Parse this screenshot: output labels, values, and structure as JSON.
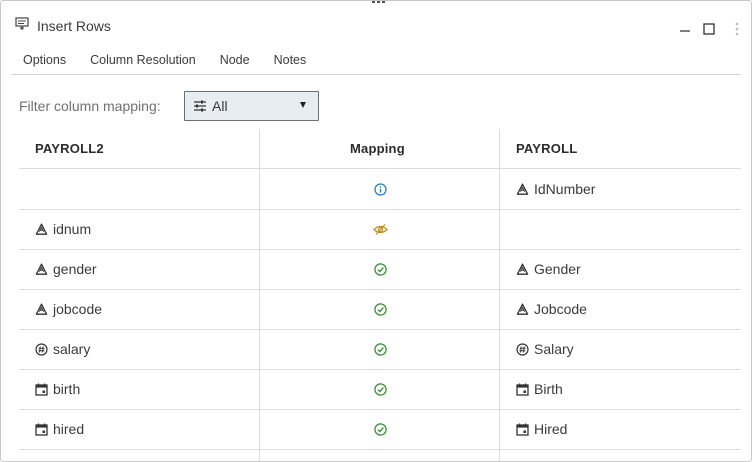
{
  "window": {
    "title": "Insert Rows"
  },
  "tabs": [
    {
      "label": "Options",
      "active": false
    },
    {
      "label": "Column Resolution",
      "active": true
    },
    {
      "label": "Node",
      "active": false
    },
    {
      "label": "Notes",
      "active": false
    }
  ],
  "filter": {
    "label": "Filter column mapping:",
    "selected": "All"
  },
  "table": {
    "headers": {
      "source": "PAYROLL2",
      "mapping": "Mapping",
      "target": "PAYROLL"
    },
    "rows": [
      {
        "source": "",
        "source_type": "",
        "mapping": "info-icon",
        "target": "IdNumber",
        "target_type": "character-icon"
      },
      {
        "source": "idnum",
        "source_type": "character-icon",
        "mapping": "hidden-icon",
        "target": "",
        "target_type": ""
      },
      {
        "source": "gender",
        "source_type": "character-icon",
        "mapping": "check-icon",
        "target": "Gender",
        "target_type": "character-icon"
      },
      {
        "source": "jobcode",
        "source_type": "character-icon",
        "mapping": "check-icon",
        "target": "Jobcode",
        "target_type": "character-icon"
      },
      {
        "source": "salary",
        "source_type": "numeric-icon",
        "mapping": "check-icon",
        "target": "Salary",
        "target_type": "numeric-icon"
      },
      {
        "source": "birth",
        "source_type": "date-icon",
        "mapping": "check-icon",
        "target": "Birth",
        "target_type": "date-icon"
      },
      {
        "source": "hired",
        "source_type": "date-icon",
        "mapping": "check-icon",
        "target": "Hired",
        "target_type": "date-icon"
      }
    ]
  },
  "colors": {
    "info": "#1f7ab8",
    "ok": "#2e8b2e",
    "warn": "#c08a1e",
    "text": "#3b3b3b"
  }
}
